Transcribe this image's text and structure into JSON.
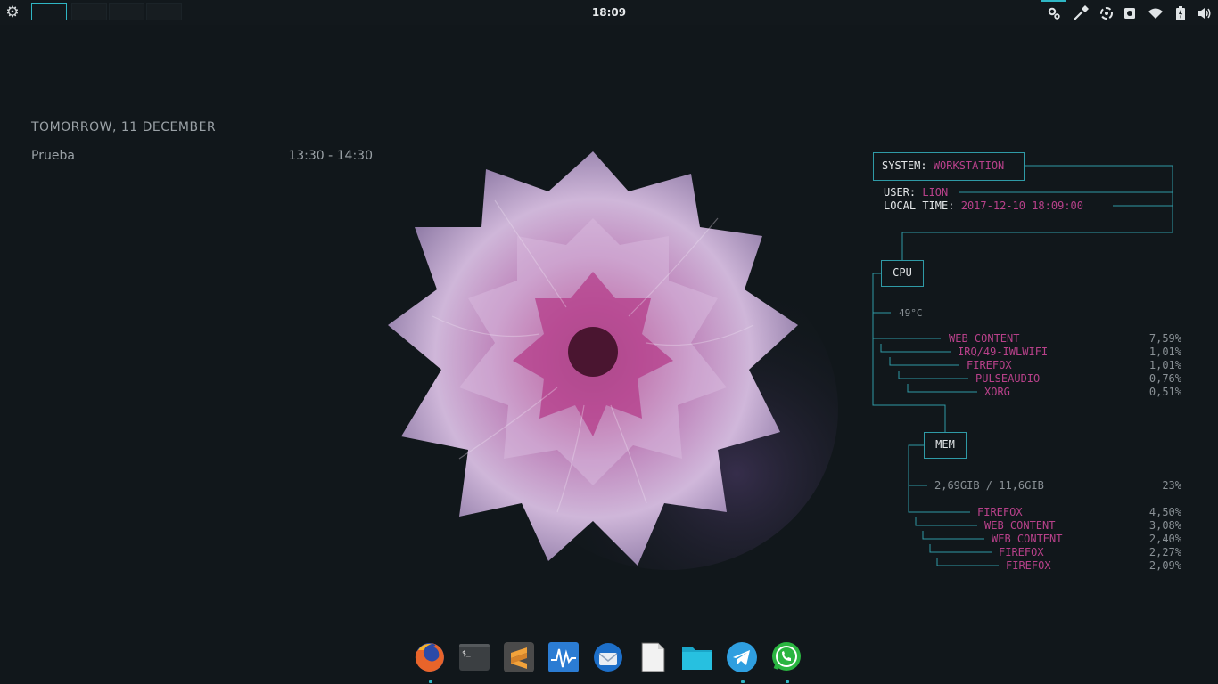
{
  "topbar": {
    "clock": "18:09",
    "workspaces": [
      {
        "name": "workspace-1",
        "active": true
      },
      {
        "name": "workspace-2",
        "active": false
      },
      {
        "name": "workspace-3",
        "active": false
      },
      {
        "name": "workspace-4",
        "active": false
      }
    ],
    "tray_icons": [
      "settings-icon",
      "color-picker-icon",
      "sync-icon",
      "disk-icon",
      "wifi-icon",
      "battery-icon",
      "volume-icon"
    ],
    "accent_color": "#2fb6c4"
  },
  "calendar": {
    "heading": "TOMORROW,  11 DECEMBER",
    "event_title": "Prueba",
    "event_time": "13:30 - 14:30"
  },
  "conky": {
    "system_label": "SYSTEM:",
    "system_value": "WORKSTATION",
    "user_label": "USER:",
    "user_value": "LION",
    "localtime_label": "LOCAL TIME:",
    "localtime_value": "2017-12-10 18:09:00",
    "cpu_label": "CPU",
    "cpu_temp": "49°C",
    "cpu_processes": [
      {
        "name": "WEB CONTENT",
        "value": "7,59%"
      },
      {
        "name": "IRQ/49-IWLWIFI",
        "value": "1,01%"
      },
      {
        "name": "FIREFOX",
        "value": "1,01%"
      },
      {
        "name": "PULSEAUDIO",
        "value": "0,76%"
      },
      {
        "name": "XORG",
        "value": "0,51%"
      }
    ],
    "mem_label": "MEM",
    "mem_usage": "2,69GIB / 11,6GIB",
    "mem_percent": "23%",
    "mem_processes": [
      {
        "name": "FIREFOX",
        "value": "4,50%"
      },
      {
        "name": "WEB CONTENT",
        "value": "3,08%"
      },
      {
        "name": "WEB CONTENT",
        "value": "2,40%"
      },
      {
        "name": "FIREFOX",
        "value": "2,27%"
      },
      {
        "name": "FIREFOX",
        "value": "2,09%"
      }
    ],
    "line_color": "#2f9aa6",
    "value_color": "#b8418a"
  },
  "dock": {
    "apps": [
      {
        "icon": "firefox-icon",
        "running": true
      },
      {
        "icon": "terminal-icon",
        "running": false
      },
      {
        "icon": "sublime-text-icon",
        "running": false
      },
      {
        "icon": "system-monitor-icon",
        "running": false
      },
      {
        "icon": "thunderbird-icon",
        "running": false
      },
      {
        "icon": "text-editor-icon",
        "running": false
      },
      {
        "icon": "file-manager-icon",
        "running": false
      },
      {
        "icon": "telegram-icon",
        "running": true
      },
      {
        "icon": "whatsapp-icon",
        "running": true
      }
    ]
  }
}
